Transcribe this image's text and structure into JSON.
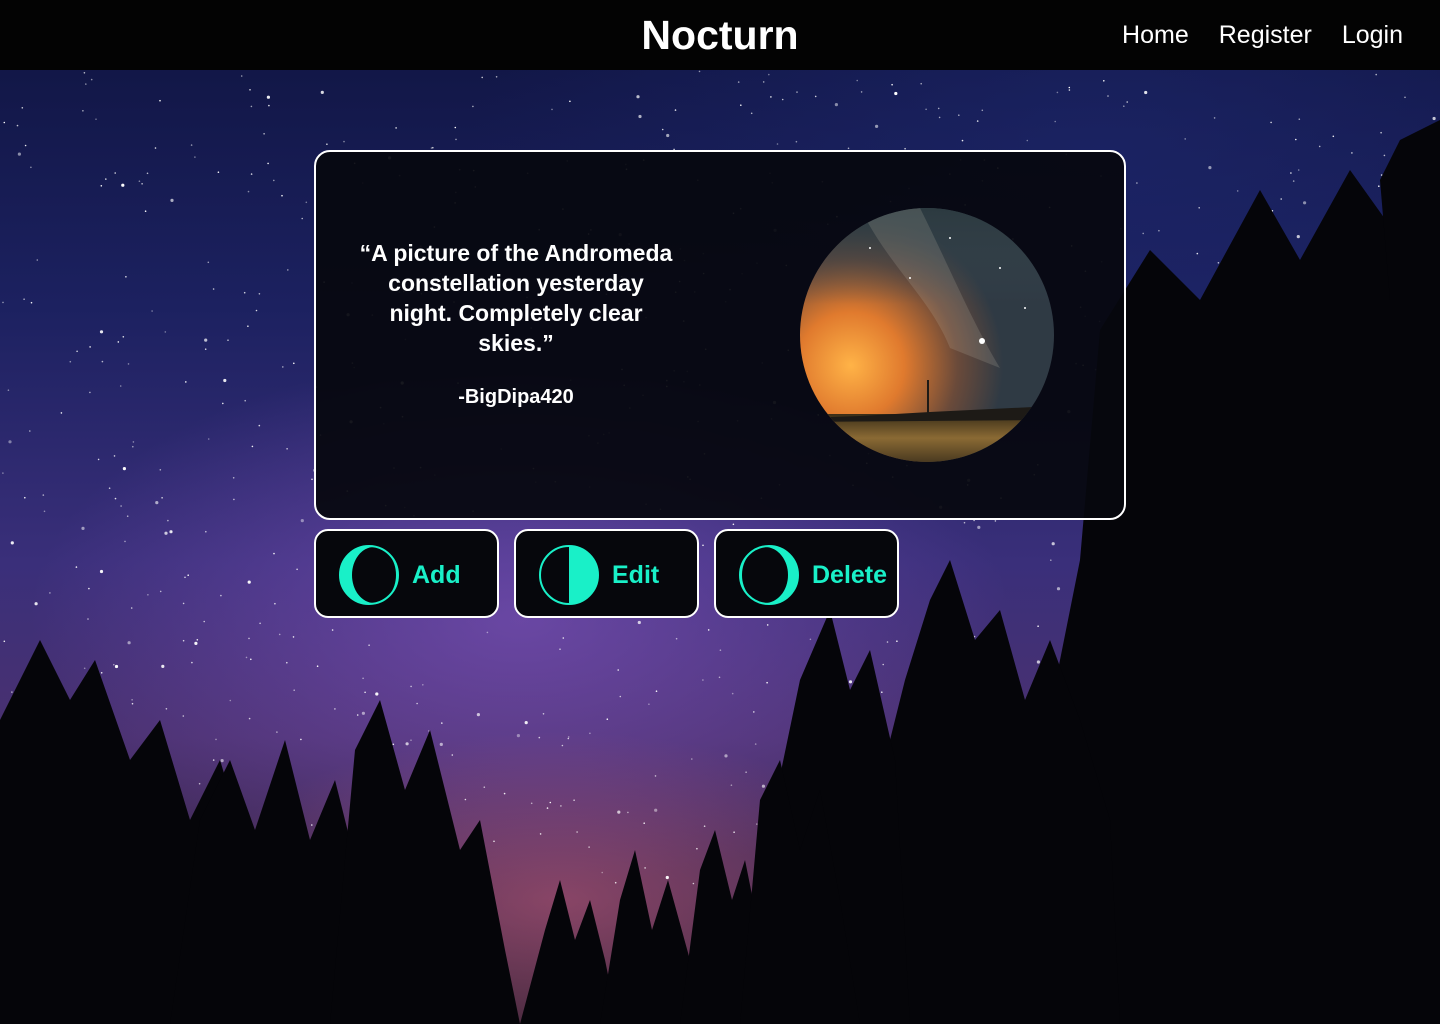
{
  "header": {
    "brand": "Nocturn",
    "nav": [
      {
        "label": "Home"
      },
      {
        "label": "Register"
      },
      {
        "label": "Login"
      }
    ]
  },
  "post": {
    "quote": "“A picture of the Andromeda constellation yesterday night. Completely clear skies.”",
    "author": "-BigDipa420"
  },
  "actions": [
    {
      "label": "Add",
      "icon": "waxing-crescent-moon-icon"
    },
    {
      "label": "Edit",
      "icon": "half-moon-icon"
    },
    {
      "label": "Delete",
      "icon": "waning-crescent-moon-icon"
    }
  ],
  "colors": {
    "accent": "#19f0c8",
    "topbar": "#030303",
    "card_border": "#ffffff"
  }
}
